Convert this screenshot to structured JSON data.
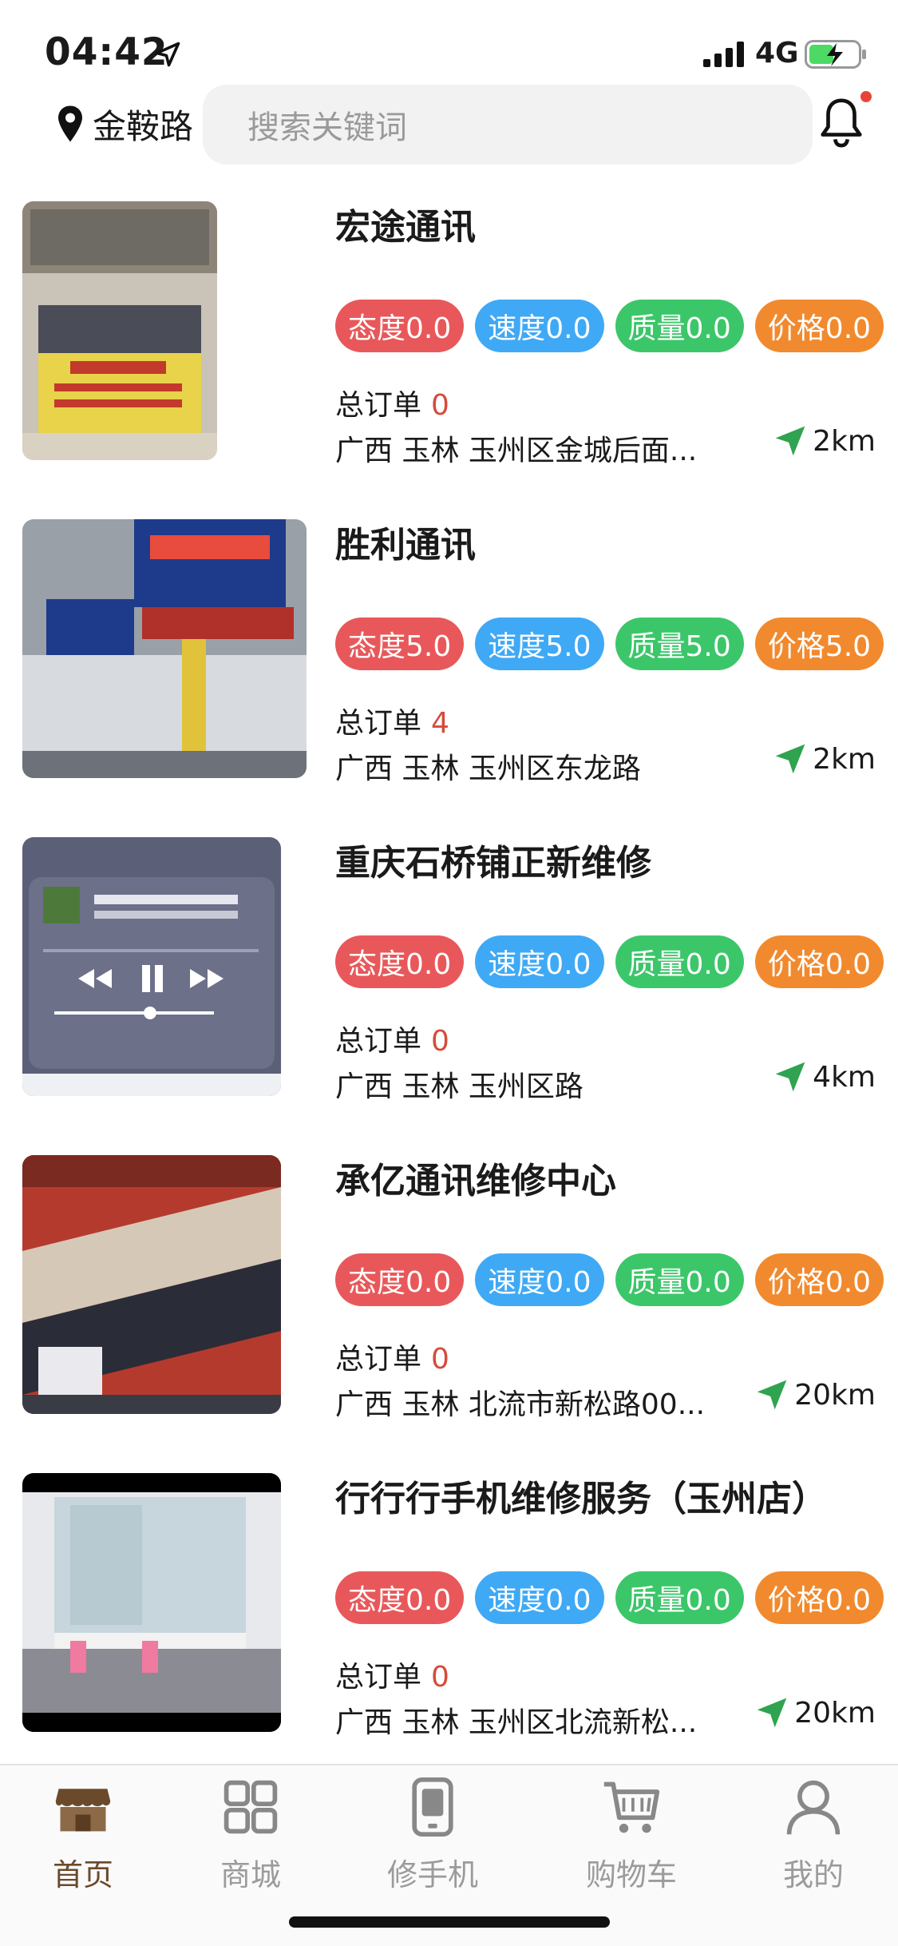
{
  "status_bar": {
    "time": "04:42",
    "network": "4G"
  },
  "header": {
    "location": "金鞍路",
    "search_placeholder": "搜索关键词"
  },
  "badge_labels": {
    "attitude": "态度",
    "speed": "速度",
    "quality": "质量",
    "price": "价格"
  },
  "orders_label": "总订单",
  "shops": [
    {
      "name": "宏途通讯",
      "ratings": {
        "attitude": "态度0.0",
        "speed": "速度0.0",
        "quality": "质量0.0",
        "price": "价格0.0"
      },
      "orders": "0",
      "address": "广西 玉林 玉州区金城后面...",
      "distance": "2km"
    },
    {
      "name": "胜利通讯",
      "ratings": {
        "attitude": "态度5.0",
        "speed": "速度5.0",
        "quality": "质量5.0",
        "price": "价格5.0"
      },
      "orders": "4",
      "address": "广西 玉林 玉州区东龙路",
      "distance": "2km"
    },
    {
      "name": "重庆石桥铺正新维修",
      "ratings": {
        "attitude": "态度0.0",
        "speed": "速度0.0",
        "quality": "质量0.0",
        "price": "价格0.0"
      },
      "orders": "0",
      "address": "广西 玉林 玉州区路",
      "distance": "4km"
    },
    {
      "name": "承亿通讯维修中心",
      "ratings": {
        "attitude": "态度0.0",
        "speed": "速度0.0",
        "quality": "质量0.0",
        "price": "价格0.0"
      },
      "orders": "0",
      "address": "广西 玉林 北流市新松路00...",
      "distance": "20km"
    },
    {
      "name": "行行行手机维修服务（玉州店）",
      "ratings": {
        "attitude": "态度0.0",
        "speed": "速度0.0",
        "quality": "质量0.0",
        "price": "价格0.0"
      },
      "orders": "0",
      "address": "广西 玉林 玉州区北流新松...",
      "distance": "20km"
    }
  ],
  "tabs": [
    {
      "label": "首页",
      "icon": "shop-icon",
      "active": true
    },
    {
      "label": "商城",
      "icon": "grid-icon",
      "active": false
    },
    {
      "label": "修手机",
      "icon": "phone-icon",
      "active": false
    },
    {
      "label": "购物车",
      "icon": "cart-icon",
      "active": false
    },
    {
      "label": "我的",
      "icon": "user-icon",
      "active": false
    }
  ],
  "colors": {
    "attitude": "#e8585a",
    "speed": "#3fa9f5",
    "quality": "#3cc66a",
    "price": "#f18a2e",
    "active_tab": "#6b4a2b",
    "order_count": "#d64b3b"
  }
}
